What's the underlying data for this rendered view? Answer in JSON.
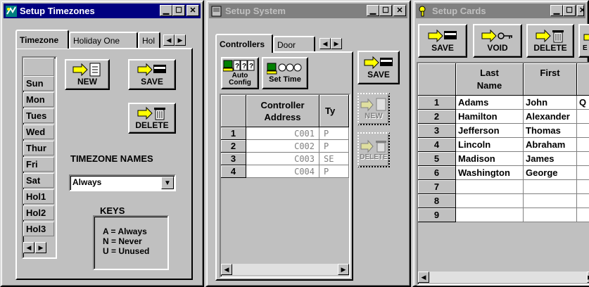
{
  "win1": {
    "title": "Setup Timezones",
    "tabs": [
      "Timezone",
      "Holiday One",
      "Hol"
    ],
    "days": [
      "Sun",
      "Mon",
      "Tues",
      "Wed",
      "Thur",
      "Fri",
      "Sat",
      "Hol1",
      "Hol2",
      "Hol3"
    ],
    "buttons": {
      "new": "NEW",
      "save": "SAVE",
      "delete": "DELETE"
    },
    "names_label": "TIMEZONE NAMES",
    "names_value": "Always",
    "keys_label": "KEYS",
    "keys": [
      "A = Always",
      "N = Never",
      "U = Unused"
    ]
  },
  "win2": {
    "title": "Setup System",
    "tabs": [
      "Controllers",
      "Door"
    ],
    "buttons": {
      "auto_config": "Auto Config",
      "set_time": "Set Time",
      "save": "SAVE",
      "new": "NEW",
      "delete": "DELETE"
    },
    "columns": [
      "Controller Address",
      "Ty"
    ],
    "rows": [
      {
        "n": "1",
        "addr": "C001",
        "type": "P"
      },
      {
        "n": "2",
        "addr": "C002",
        "type": "P"
      },
      {
        "n": "3",
        "addr": "C003",
        "type": "SE"
      },
      {
        "n": "4",
        "addr": "C004",
        "type": "P"
      }
    ]
  },
  "win3": {
    "title": "Setup Cards",
    "buttons": {
      "save": "SAVE",
      "void": "VOID",
      "delete": "DELETE",
      "partial": "E"
    },
    "columns": [
      "Last Name",
      "First",
      ""
    ],
    "rows": [
      {
        "n": "1",
        "last": "Adams",
        "first": "John",
        "extra": "Q"
      },
      {
        "n": "2",
        "last": "Hamilton",
        "first": "Alexander",
        "extra": ""
      },
      {
        "n": "3",
        "last": "Jefferson",
        "first": "Thomas",
        "extra": ""
      },
      {
        "n": "4",
        "last": "Lincoln",
        "first": "Abraham",
        "extra": ""
      },
      {
        "n": "5",
        "last": "Madison",
        "first": "James",
        "extra": ""
      },
      {
        "n": "6",
        "last": "Washington",
        "first": "George",
        "extra": ""
      },
      {
        "n": "7",
        "last": "",
        "first": "",
        "extra": ""
      },
      {
        "n": "8",
        "last": "",
        "first": "",
        "extra": ""
      },
      {
        "n": "9",
        "last": "",
        "first": "",
        "extra": ""
      }
    ]
  },
  "colors": {
    "active_title": "#000080",
    "inactive_title": "#808080",
    "face": "#c0c0c0",
    "arrow": "#ffff00"
  },
  "icons": [
    "timezones-app-icon",
    "system-app-icon",
    "cards-app-icon",
    "minimize-icon",
    "maximize-icon",
    "close-icon",
    "arrow-document-icon",
    "arrow-bar-icon",
    "arrow-trash-icon",
    "arrow-key-icon",
    "computer-question-icon",
    "computer-clock-icon"
  ]
}
